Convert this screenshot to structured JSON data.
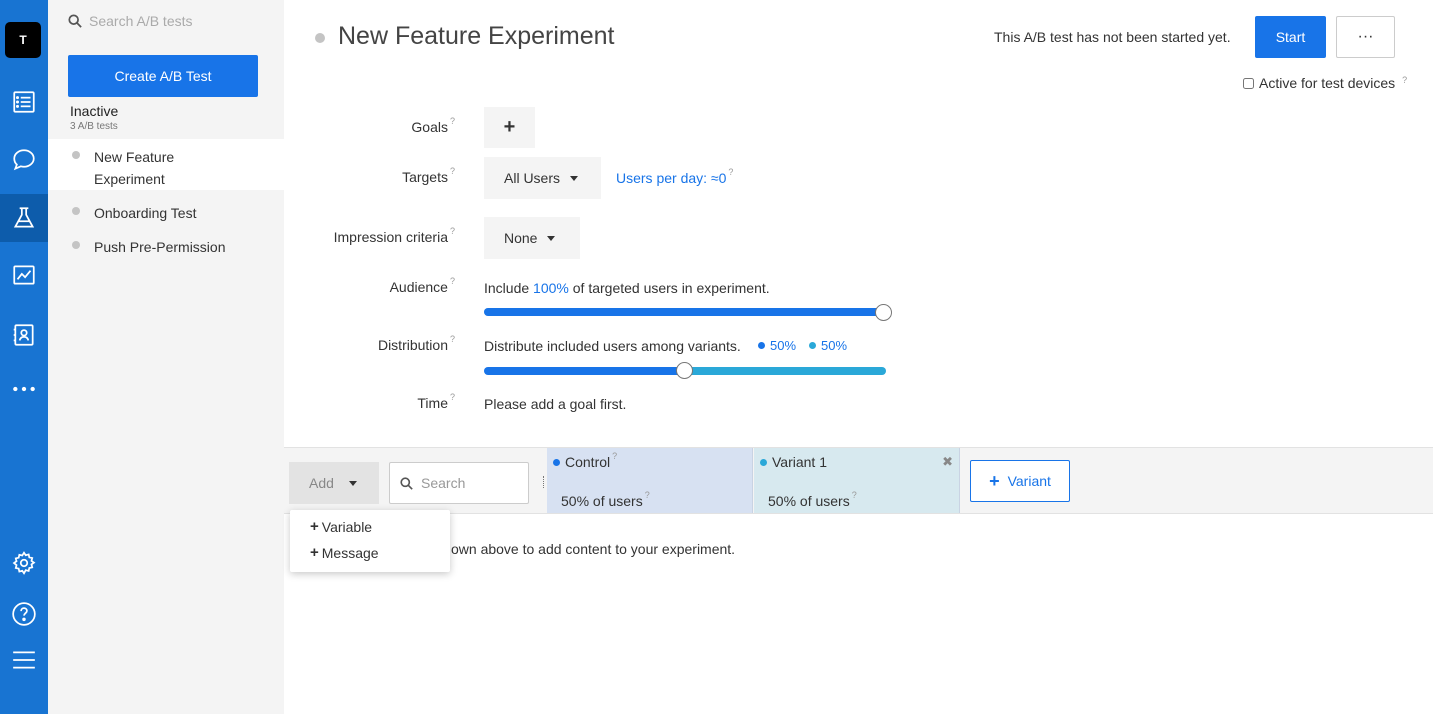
{
  "rail": {
    "logo_letter": "T",
    "icons": [
      "list-icon",
      "chat-bubble-icon",
      "flask-icon",
      "chart-line-icon",
      "contact-card-icon",
      "more-dots-icon",
      "gear-icon",
      "help-icon",
      "menu-icon"
    ]
  },
  "sidebar": {
    "search_placeholder": "Search A/B tests",
    "create_label": "Create A/B Test",
    "group_title": "Inactive",
    "group_count": "3 A/B tests",
    "tests": [
      {
        "label": "New Feature Experiment"
      },
      {
        "label": "Onboarding Test"
      },
      {
        "label": "Push Pre-Permission"
      }
    ]
  },
  "header": {
    "title": "New Feature Experiment",
    "status_text": "This A/B test has not been started yet.",
    "start_label": "Start",
    "more_label": "···",
    "active_devices_label": "Active for test devices"
  },
  "form": {
    "goals_label": "Goals",
    "goals_add": "+",
    "targets_label": "Targets",
    "targets_value": "All Users",
    "users_per_day": "Users per day: ≈0",
    "impression_label": "Impression criteria",
    "impression_value": "None",
    "audience_label": "Audience",
    "audience_prefix": "Include",
    "audience_percent": "100%",
    "audience_suffix": "of targeted users in experiment.",
    "audience_value_fraction": 1.0,
    "distribution_label": "Distribution",
    "distribution_text": "Distribute included users among variants.",
    "distribution_a": "50%",
    "distribution_b": "50%",
    "distribution_split_fraction": 0.5,
    "time_label": "Time",
    "time_text": "Please add a goal first.",
    "question_mark": "?"
  },
  "variants": {
    "add_label": "Add",
    "search_placeholder": "Search",
    "columns": [
      {
        "name": "Control",
        "users": "50% of users",
        "color": "#1874e8"
      },
      {
        "name": "Variant 1",
        "users": "50% of users",
        "color": "#2aa8d8"
      }
    ],
    "close_icon": "✖",
    "add_variant_label": "Variant",
    "add_variant_plus": "+",
    "helper_text": "own above to add content to your experiment."
  },
  "menu": {
    "items": [
      "Variable",
      "Message"
    ],
    "plus": "+"
  },
  "colors": {
    "primary": "#1874e8",
    "secondary": "#2aa8d8",
    "rail": "#1874d2"
  }
}
